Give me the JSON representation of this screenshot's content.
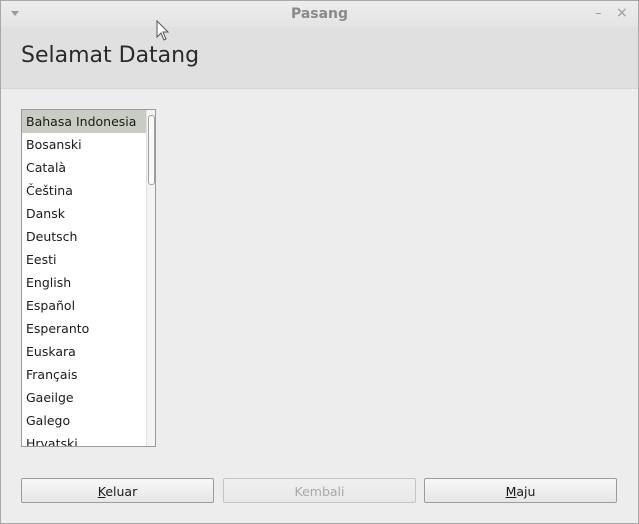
{
  "window": {
    "title": "Pasang"
  },
  "header": {
    "title": "Selamat Datang"
  },
  "languages": [
    "Bahasa Indonesia",
    "Bosanski",
    "Català",
    "Čeština",
    "Dansk",
    "Deutsch",
    "Eesti",
    "English",
    "Español",
    "Esperanto",
    "Euskara",
    "Français",
    "Gaeilge",
    "Galego",
    "Hrvatski"
  ],
  "selected_language": "Bahasa Indonesia",
  "buttons": {
    "quit": {
      "accel": "K",
      "rest": "eluar"
    },
    "back": {
      "label": "Kembali"
    },
    "forward": {
      "accel": "M",
      "rest": "aju"
    }
  },
  "colors": {
    "selection": "#c8ccc2",
    "disabled_text": "#a8a8a8"
  }
}
